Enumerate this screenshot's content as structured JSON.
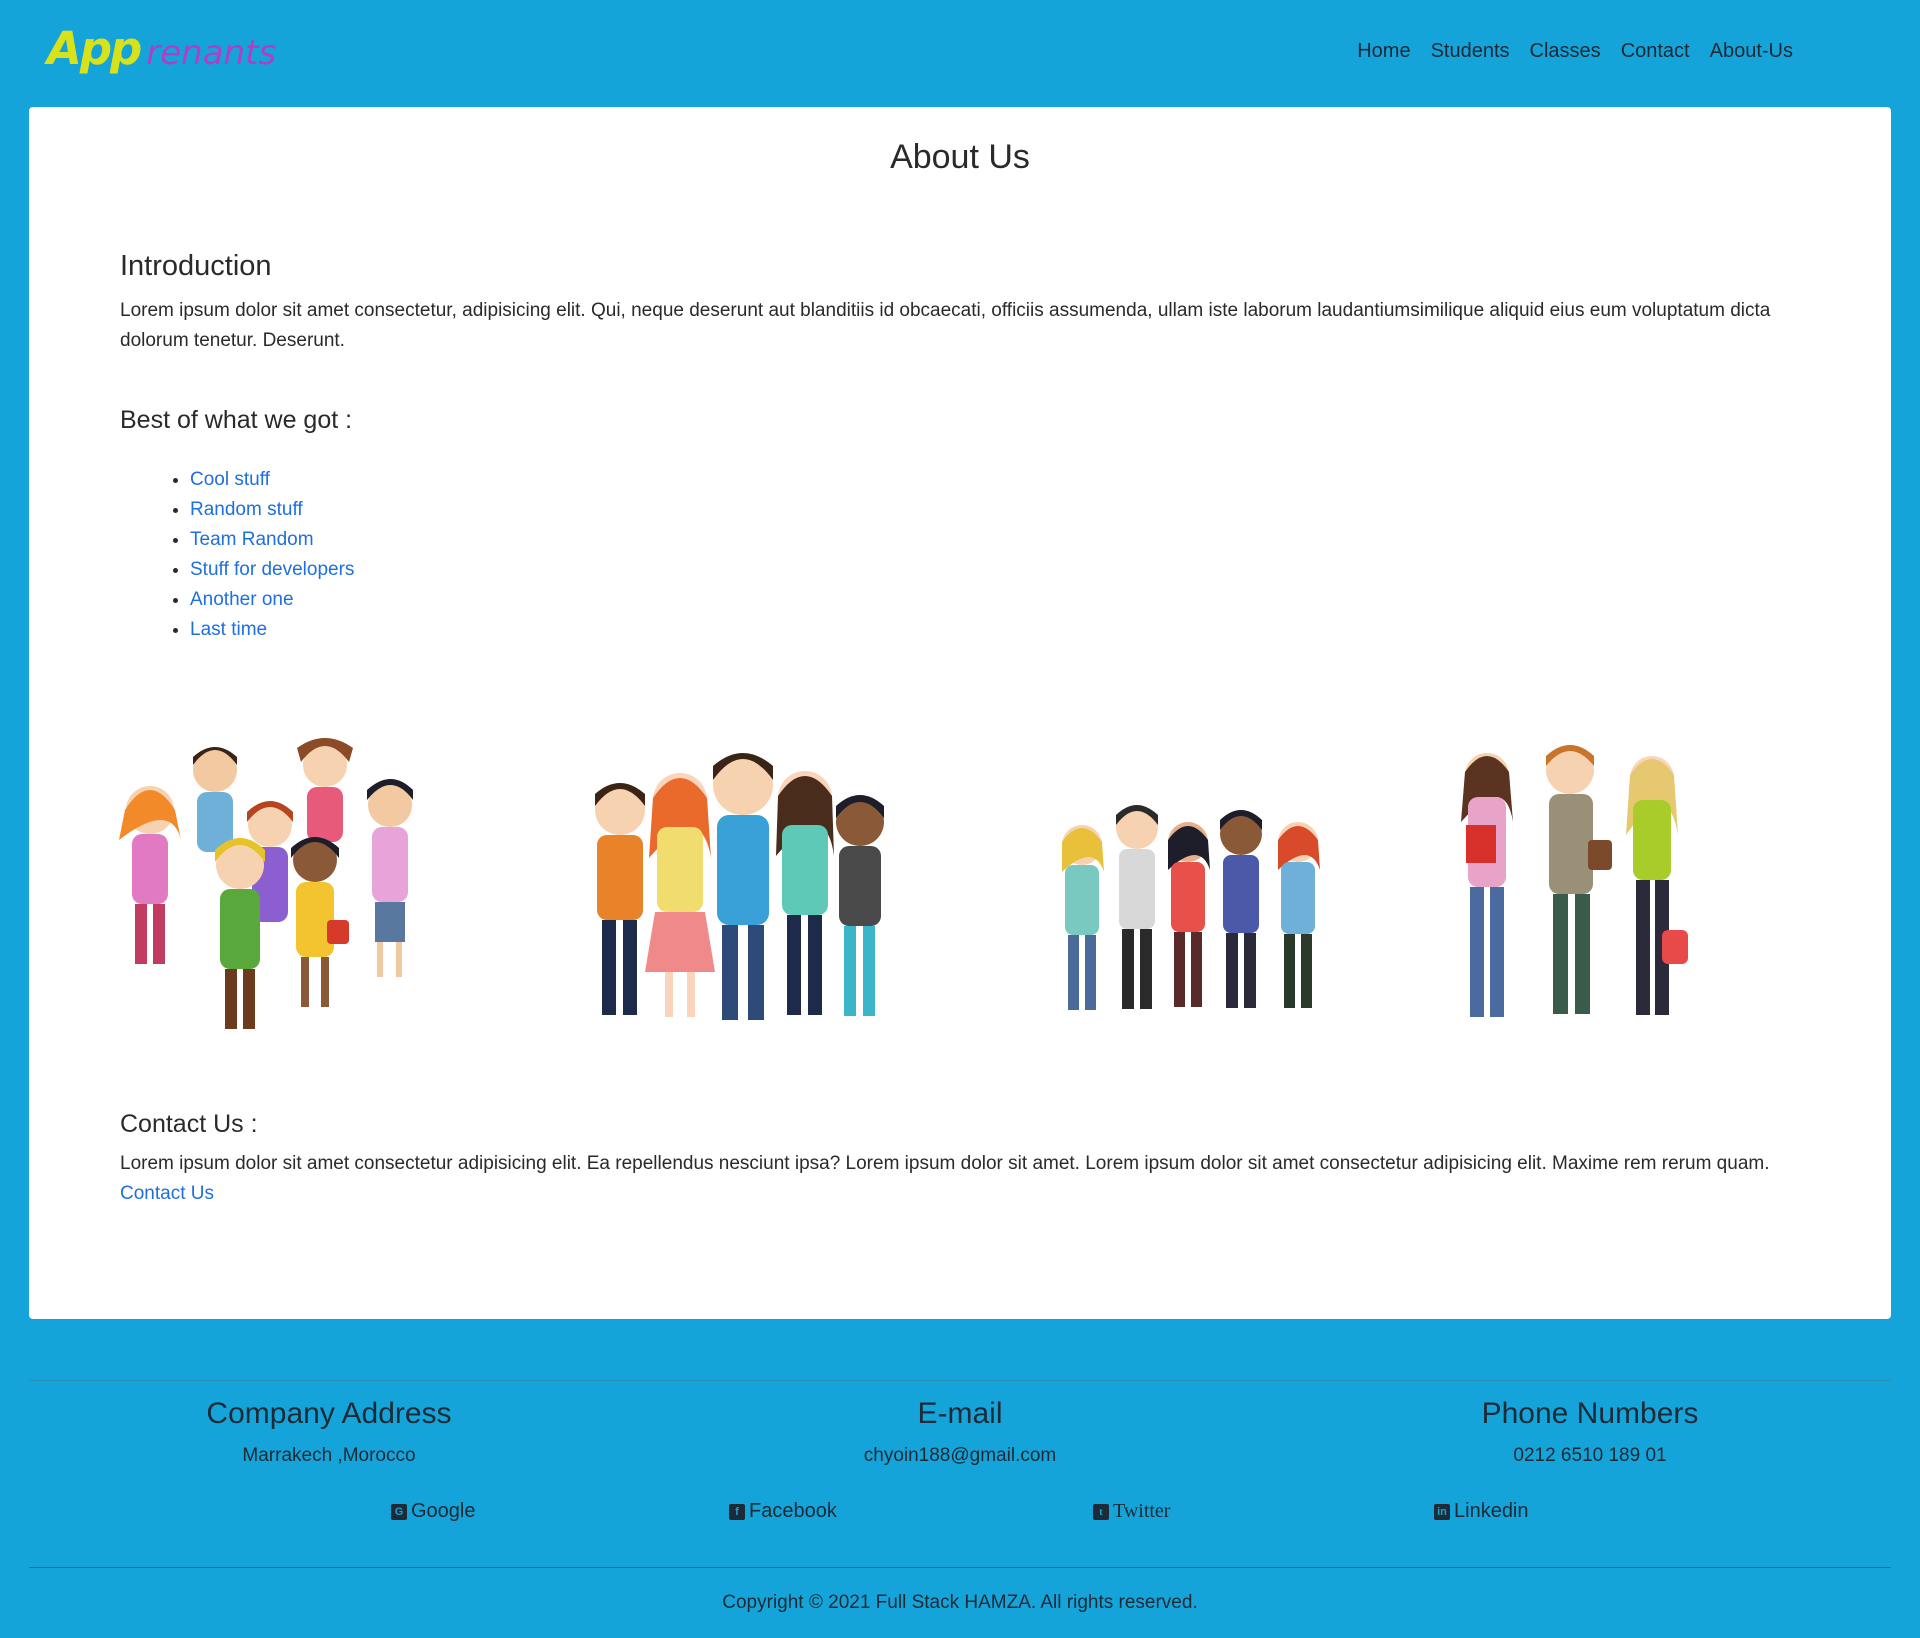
{
  "brand": {
    "part1": "App",
    "part2": "renants"
  },
  "nav": {
    "links": [
      "Home",
      "Students",
      "Classes",
      "Contact",
      "About-Us"
    ]
  },
  "main": {
    "title": "About Us",
    "intro": {
      "heading": "Introduction",
      "text": "Lorem ipsum dolor sit amet consectetur, adipisicing elit. Qui, neque deserunt aut blanditiis id obcaecati, officiis assumenda, ullam iste laborum laudantiumsimilique aliquid eius eum voluptatum dicta dolorum tenetur. Deserunt."
    },
    "best": {
      "heading": "Best of what we got :",
      "items": [
        "Cool stuff",
        "Random stuff",
        "Team Random",
        "Stuff for developers",
        "Another one",
        "Last time"
      ]
    },
    "contact": {
      "heading": "Contact Us :",
      "text": "Lorem ipsum dolor sit amet consectetur adipisicing elit. Ea repellendus nesciunt ipsa? Lorem ipsum dolor sit amet. Lorem ipsum dolor sit amet consectetur adipisicing elit. Maxime rem rerum quam.",
      "link": "Contact Us"
    }
  },
  "footer": {
    "address": {
      "heading": "Company Address",
      "value": "Marrakech ,Morocco"
    },
    "email": {
      "heading": "E-mail",
      "value": "chyoin188@gmail.com"
    },
    "phone": {
      "heading": "Phone Numbers",
      "value": "0212 6510 189 01"
    },
    "social": [
      "Google",
      "Facebook",
      "Twitter",
      "Linkedin"
    ],
    "copyright": "Copyright © 2021 Full Stack HAMZA. All rights reserved."
  },
  "colors": {
    "background": "#15a4d9",
    "brand_app": "#d8e21a",
    "brand_rest": "#b03fc4",
    "link": "#1f6fe0"
  }
}
